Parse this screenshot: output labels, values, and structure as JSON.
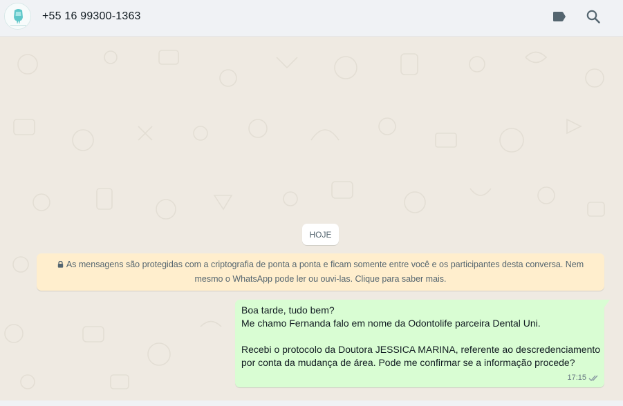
{
  "header": {
    "contact_name": "+55 16 99300-1363",
    "icons": [
      "label-icon",
      "search-icon"
    ]
  },
  "chat": {
    "date_chip": "HOJE",
    "encryption_notice": "As mensagens são protegidas com a criptografia de ponta a ponta e ficam somente entre você e os participantes desta conversa. Nem mesmo o WhatsApp pode ler ou ouvi-las. Clique para saber mais.",
    "message": {
      "lines": [
        "Boa tarde, tudo bem?",
        "Me chamo Fernanda falo em nome da Odontolife parceira Dental Uni.",
        "",
        "Recebi o protocolo da Doutora JESSICA MARINA, referente ao descredenciamento",
        "por conta da mudança de área. Pode me confirmar se a informação procede?"
      ],
      "time": "17:15",
      "status_icon": "double-check-icon"
    }
  },
  "colors": {
    "header_bg": "#f0f2f5",
    "chat_bg": "#efeae2",
    "outgoing_bubble": "#d9fdd3",
    "notice_bg": "#ffeecd",
    "icon_gray": "#54656f"
  }
}
